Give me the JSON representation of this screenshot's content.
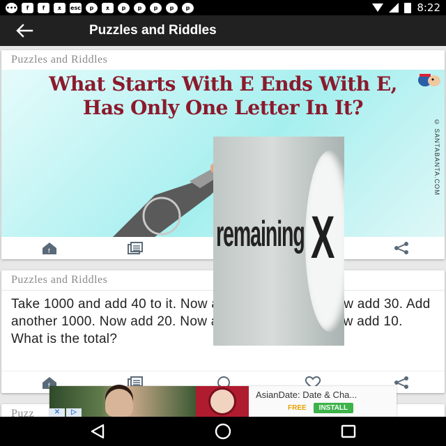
{
  "status_bar": {
    "left_icons": [
      "message-icon",
      "facebook-icon",
      "facebook-icon",
      "cat-icon",
      "esc-icon",
      "pinterest-icon",
      "cat-icon",
      "pinterest-icon",
      "pinterest-icon",
      "pinterest-icon",
      "pinterest-icon",
      "pinterest-icon"
    ],
    "esc_label": "esc",
    "time": "8:22"
  },
  "app_bar": {
    "back_icon": "arrow-left-icon",
    "title": "Puzzles and Riddles"
  },
  "cards": [
    {
      "header": "Puzzles and Riddles",
      "image_headline_line1": "What Starts With E Ends With E,",
      "image_headline_line2": "Has Only One Letter In It?",
      "image_watermark": "© SANTABANTA.COM"
    },
    {
      "header": "Puzzles and Riddles",
      "text": "Take 1000 and add 40 to it. Now add another 1000. Now add 30. Add another 1000. Now add 20. Now add another 1000. Now add 10. What is the total?"
    },
    {
      "header": "Puzz"
    }
  ],
  "overlay_ad": {
    "text": "remaining",
    "close_glyph": "X"
  },
  "banner_ad": {
    "title": "AsianDate: Date & Cha...",
    "free_label": "FREE",
    "install_label": "INSTALL"
  },
  "colors": {
    "app_bar": "#212121",
    "headline": "#8b1a2c",
    "install": "#3db34a"
  }
}
